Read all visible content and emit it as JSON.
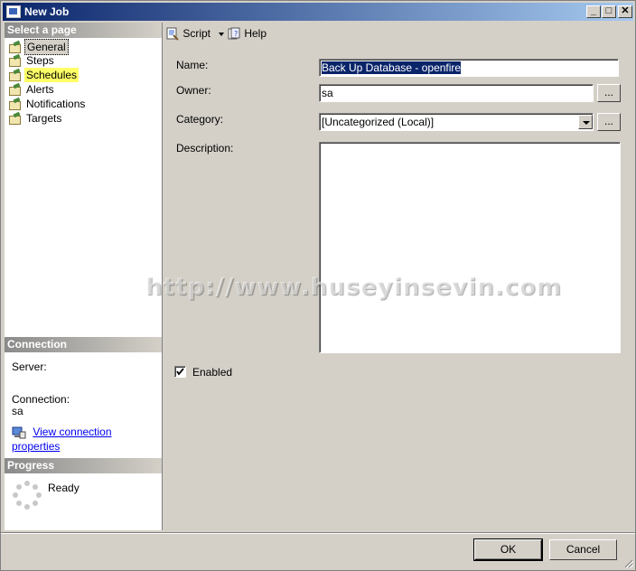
{
  "window": {
    "title": "New Job"
  },
  "title_buttons": {
    "minimize": "_",
    "maximize": "□",
    "close": "✕"
  },
  "left_panel": {
    "select_page_header": "Select a page",
    "pages": [
      {
        "label": "General"
      },
      {
        "label": "Steps"
      },
      {
        "label": "Schedules"
      },
      {
        "label": "Alerts"
      },
      {
        "label": "Notifications"
      },
      {
        "label": "Targets"
      }
    ],
    "connection": {
      "header": "Connection",
      "server_label": "Server:",
      "connection_label": "Connection:",
      "connection_value": "sa",
      "view_link": "View connection properties"
    },
    "progress": {
      "header": "Progress",
      "status": "Ready"
    }
  },
  "toolbar": {
    "script_label": "Script",
    "help_label": "Help"
  },
  "form": {
    "name_label": "Name:",
    "name_value": "Back Up Database - openfire",
    "owner_label": "Owner:",
    "owner_value": "sa",
    "category_label": "Category:",
    "category_value": "[Uncategorized (Local)]",
    "description_label": "Description:",
    "description_value": "",
    "browse_label": "...",
    "enabled_label": "Enabled",
    "enabled_checked": true
  },
  "footer": {
    "ok_label": "OK",
    "cancel_label": "Cancel"
  },
  "watermark": "http://www.huseyinsevin.com"
}
